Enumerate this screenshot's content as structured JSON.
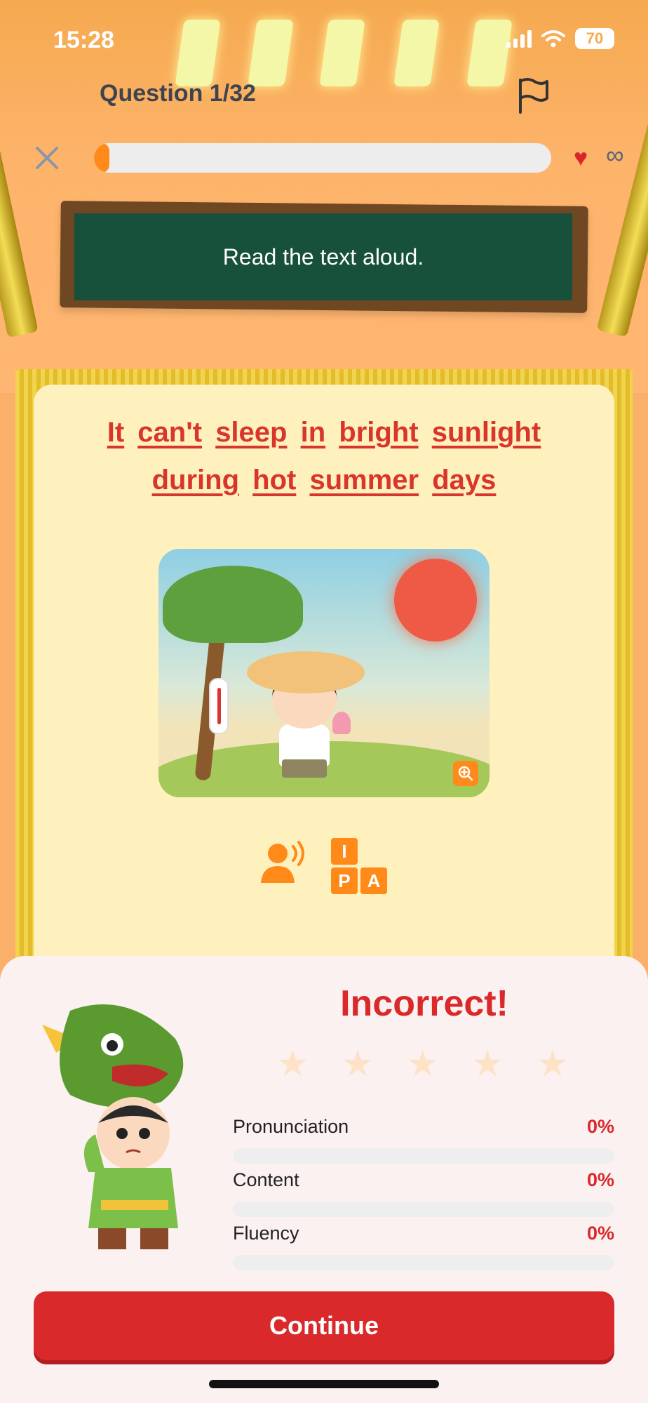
{
  "status_bar": {
    "time": "15:28",
    "battery": "70"
  },
  "header": {
    "question_label": "Question 1/32",
    "progress_fraction": 0.03,
    "lives": "∞"
  },
  "instruction": "Read the text aloud.",
  "sentence": {
    "line1": [
      "It",
      "can't",
      "sleep",
      "in",
      "bright",
      "sunlight"
    ],
    "line2": [
      "during",
      "hot",
      "summer",
      "days"
    ]
  },
  "ipa_letters": [
    "I",
    "P",
    "A"
  ],
  "result": {
    "title": "Incorrect!",
    "stars_earned": 0,
    "stars_total": 5,
    "metrics": [
      {
        "label": "Pronunciation",
        "value": "0%",
        "fraction": 0
      },
      {
        "label": "Content",
        "value": "0%",
        "fraction": 0
      },
      {
        "label": "Fluency",
        "value": "0%",
        "fraction": 0
      }
    ]
  },
  "continue_label": "Continue",
  "colors": {
    "accent_orange": "#ff8a1a",
    "error_red": "#d9292b",
    "board_green": "#17503b",
    "card_bg": "#fff1be"
  },
  "icons": [
    "close-icon",
    "flag-icon",
    "heart-icon",
    "zoom-icon",
    "speaker-icon",
    "ipa-icon",
    "star-icon"
  ]
}
